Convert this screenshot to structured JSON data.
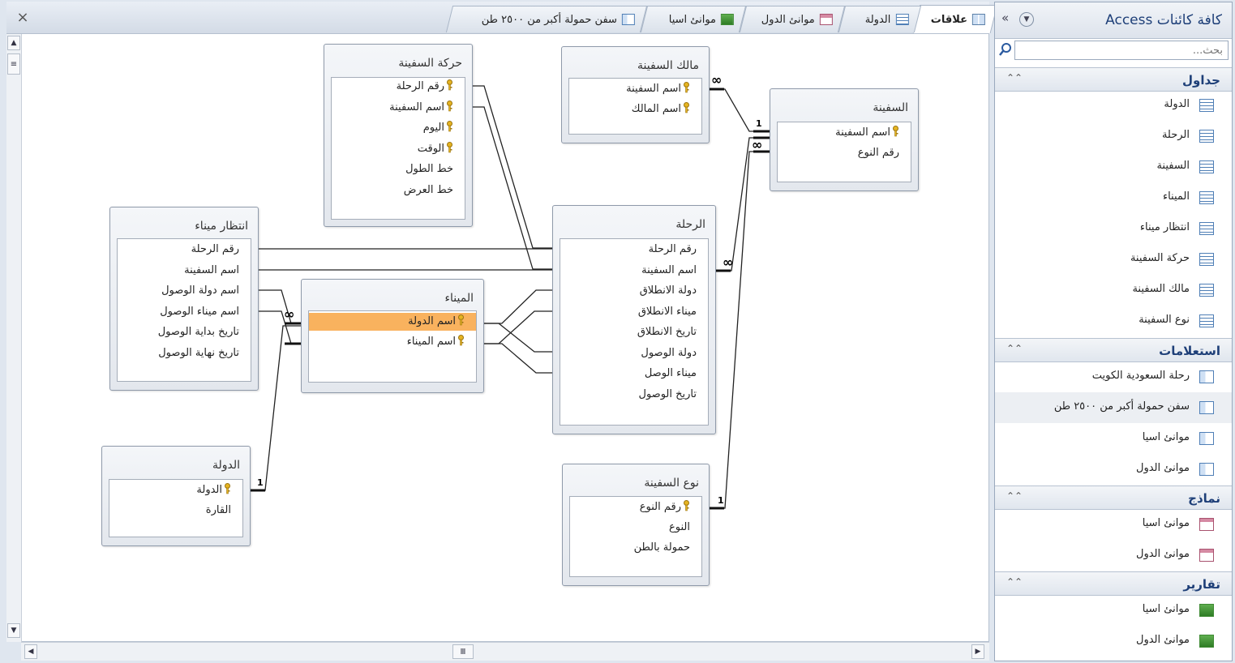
{
  "tabs": [
    {
      "label": "علاقات",
      "icon": "relationships-icon",
      "active": true
    },
    {
      "label": "الدولة",
      "icon": "table-icon"
    },
    {
      "label": "موانئ الدول",
      "icon": "form-icon"
    },
    {
      "label": "موانئ اسيا",
      "icon": "report-icon"
    },
    {
      "label": "سفن حمولة أكبر من ٢٥٠٠ طن",
      "icon": "query-icon"
    }
  ],
  "close_label": "×",
  "tables": {
    "harakat_safina": {
      "title": "حركة السفينة",
      "fields": [
        {
          "name": "رقم الرحلة",
          "key": true
        },
        {
          "name": "اسم السفينة",
          "key": true
        },
        {
          "name": "اليوم",
          "key": true
        },
        {
          "name": "الوقت",
          "key": true
        },
        {
          "name": "خط الطول",
          "key": false
        },
        {
          "name": "خط العرض",
          "key": false
        }
      ]
    },
    "malik_safina": {
      "title": "مالك السفينة",
      "fields": [
        {
          "name": "اسم السفينة",
          "key": true
        },
        {
          "name": "اسم المالك",
          "key": true
        }
      ]
    },
    "safina": {
      "title": "السفينة",
      "fields": [
        {
          "name": "اسم السفينة",
          "key": true
        },
        {
          "name": "رقم النوع",
          "key": false
        }
      ]
    },
    "intizar_mina": {
      "title": "انتظار ميناء",
      "fields": [
        {
          "name": "رقم الرحلة",
          "key": false
        },
        {
          "name": "اسم السفينة",
          "key": false
        },
        {
          "name": "اسم دولة الوصول",
          "key": false
        },
        {
          "name": "اسم ميناء الوصول",
          "key": false
        },
        {
          "name": "تاريخ بداية الوصول",
          "key": false
        },
        {
          "name": "تاريخ نهاية الوصول",
          "key": false
        }
      ]
    },
    "mina": {
      "title": "الميناء",
      "fields": [
        {
          "name": "اسم الدولة",
          "key": true,
          "selected": true
        },
        {
          "name": "اسم الميناء",
          "key": true
        }
      ]
    },
    "rihla": {
      "title": "الرحلة",
      "fields": [
        {
          "name": "رقم الرحلة",
          "key": false
        },
        {
          "name": "اسم السفينة",
          "key": false
        },
        {
          "name": "دولة الانطلاق",
          "key": false
        },
        {
          "name": "ميناء الانطلاق",
          "key": false
        },
        {
          "name": "تاريخ الانطلاق",
          "key": false
        },
        {
          "name": "دولة الوصول",
          "key": false
        },
        {
          "name": "ميناء الوصل",
          "key": false
        },
        {
          "name": "تاريخ الوصول",
          "key": false
        }
      ]
    },
    "dawla": {
      "title": "الدولة",
      "fields": [
        {
          "name": "الدولة",
          "key": true
        },
        {
          "name": "القارة",
          "key": false
        }
      ]
    },
    "naw_safina": {
      "title": "نوع السفينة",
      "fields": [
        {
          "name": "رقم النوع",
          "key": true
        },
        {
          "name": "النوع",
          "key": false
        },
        {
          "name": "حمولة بالطن",
          "key": false
        }
      ]
    }
  },
  "cardinality": {
    "one": "1",
    "many": "∞"
  },
  "nav": {
    "title": "كافة كائنات Access",
    "search_placeholder": "بحث...",
    "groups": [
      {
        "label": "جداول",
        "icon": "table-icon",
        "items": [
          "الدولة",
          "الرحلة",
          "السفينة",
          "الميناء",
          "انتظار ميناء",
          "حركة السفينة",
          "مالك السفينة",
          "نوع السفينة"
        ]
      },
      {
        "label": "استعلامات",
        "icon": "query-icon",
        "items": [
          "رحلة السعودية الكويت",
          "سفن حمولة أكبر من ٢٥٠٠ طن",
          "موانئ اسيا",
          "موانئ الدول"
        ]
      },
      {
        "label": "نماذج",
        "icon": "form-icon",
        "items": [
          "موانئ اسيا",
          "موانئ الدول"
        ]
      },
      {
        "label": "تقارير",
        "icon": "report-icon",
        "items": [
          "موانئ اسيا",
          "موانئ الدول"
        ]
      }
    ]
  }
}
